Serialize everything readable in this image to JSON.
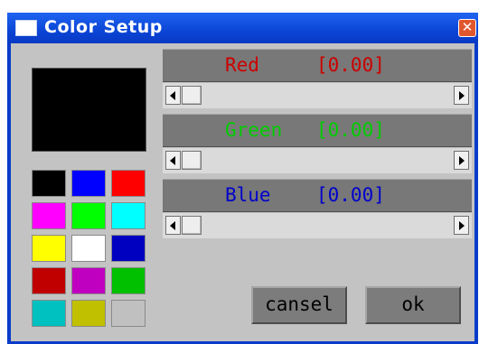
{
  "window": {
    "title": "Color Setup",
    "close_glyph": "✕"
  },
  "preview": {
    "color": "#000000"
  },
  "swatches": [
    "#000000",
    "#0000ff",
    "#ff0000",
    "#ff00ff",
    "#00ff00",
    "#00ffff",
    "#ffff00",
    "#ffffff",
    "#0000c0",
    "#c00000",
    "#c000c0",
    "#00c000",
    "#00c0c0",
    "#c0c000",
    "#c0c0c0"
  ],
  "channels": [
    {
      "name": "Red",
      "value": "[0.00]",
      "color": "#cc0000",
      "level": 0
    },
    {
      "name": "Green",
      "value": "[0.00]",
      "color": "#00cc00",
      "level": 0
    },
    {
      "name": "Blue",
      "value": "[0.00]",
      "color": "#0000cc",
      "level": 0
    }
  ],
  "buttons": {
    "cancel_label": "cansel",
    "ok_label": "ok"
  },
  "icons": {
    "title": "window-icon",
    "close": "close-icon",
    "scroll_left": "arrow-left-icon",
    "scroll_right": "arrow-right-icon"
  }
}
